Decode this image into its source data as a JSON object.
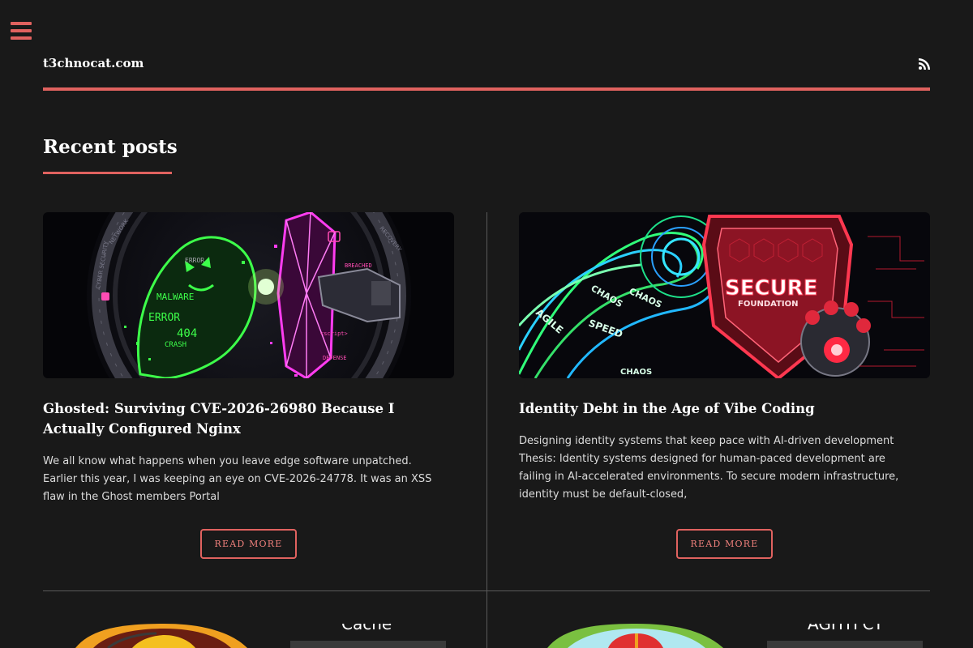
{
  "site": {
    "title": "t3chnocat.com"
  },
  "section": {
    "title": "Recent posts"
  },
  "posts": [
    {
      "title": "Ghosted: Surviving CVE-2026-26980 Because I Actually Configured Nginx",
      "excerpt": "We all know what happens when you leave edge software unpatched. Earlier this year, I was keeping an eye on CVE-2026-24778. It was an XSS flaw in the Ghost members Portal",
      "button": "READ MORE",
      "image_text": {
        "error": "ERROR",
        "malware": "MALWARE",
        "code404": "404",
        "crash": "CRASH",
        "breached": "BREACHED",
        "defense": "DEFENSE",
        "script": "<script>",
        "ring_top": "NETWORK",
        "ring_left": "CYBER SECURITY",
        "ring_right": "RECOVERY"
      }
    },
    {
      "title": "Identity Debt in the Age of Vibe Coding",
      "excerpt": "Designing identity systems that keep pace with AI-driven development Thesis: Identity systems designed for human-paced development are failing in AI-accelerated environments. To secure modern infrastructure, identity must be default-closed,",
      "button": "READ MORE",
      "image_text": {
        "secure": "SECURE",
        "foundation": "FOUNDATION",
        "chaos1": "CHAOS",
        "chaos2": "CHAOS",
        "chaos3": "CHAOS",
        "speed": "SPEED",
        "agile": "AGILE"
      }
    }
  ],
  "peek": [
    {
      "word": "Cache"
    },
    {
      "word": "AGHTFCY"
    }
  ],
  "colors": {
    "accent": "#e0625f",
    "background": "#191919"
  },
  "icons": {
    "menu": "hamburger-menu-icon",
    "rss": "rss-icon"
  }
}
